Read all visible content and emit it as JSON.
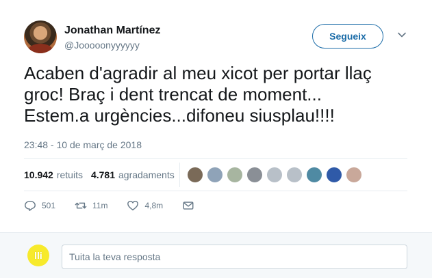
{
  "author": {
    "name": "Jonathan Martínez",
    "handle": "@Jooooonyyyyyy"
  },
  "follow_label": "Segueix",
  "tweet_text": "Acaben d'agradir al meu xicot per portar llaç\ngroc! Braç i dent trencat de moment...\nEstem.a urgències...difoneu siusplau!!!!",
  "timestamp": "23:48 - 10 de març de 2018",
  "stats": {
    "retweets_count": "10.942",
    "retweets_label": "retuits",
    "likes_count": "4.781",
    "likes_label": "agradaments"
  },
  "likers": [
    {
      "name": "liker-1",
      "color": "#7a6a58"
    },
    {
      "name": "liker-2",
      "color": "#8fa3b8"
    },
    {
      "name": "liker-3",
      "color": "#a7b5a0"
    },
    {
      "name": "liker-4",
      "color": "#8a8f96"
    },
    {
      "name": "liker-5",
      "color": "#b8c0c8"
    },
    {
      "name": "liker-6",
      "color": "#b8c0c8"
    },
    {
      "name": "liker-7",
      "color": "#4f8aa3"
    },
    {
      "name": "liker-8",
      "color": "#2f5aa8"
    },
    {
      "name": "liker-9",
      "color": "#c9a89a"
    }
  ],
  "actions": {
    "replies": "501",
    "retweets": "11m",
    "likes": "4,8m"
  },
  "reply": {
    "avatar_text": "lli",
    "placeholder": "Tuita la teva resposta"
  },
  "colors": {
    "accent": "#1b6ca8",
    "muted": "#657786",
    "reply_avatar": "#f7ea2c"
  }
}
